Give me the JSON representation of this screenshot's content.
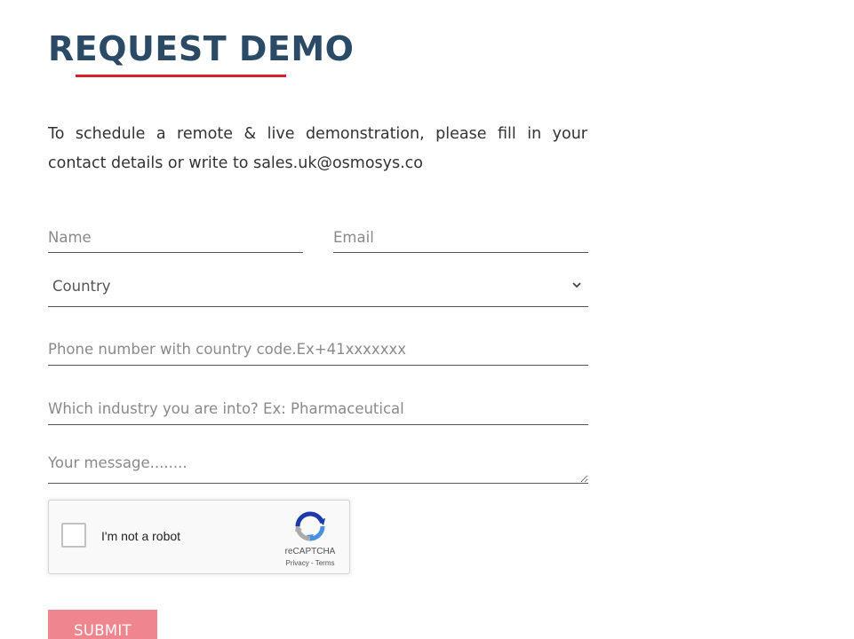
{
  "heading": {
    "title": "REQUEST DEMO",
    "accent_color": "#d3212d",
    "title_color": "#2b4a66"
  },
  "intro": {
    "text": "To schedule a remote & live demonstration, please fill in your contact details or write to sales.uk@osmosys.co"
  },
  "form": {
    "name_placeholder": "Name",
    "email_placeholder": "Email",
    "country": {
      "selected": "Country",
      "icon": "chevron-down-icon"
    },
    "phone_placeholder": "Phone number with country code.Ex+41xxxxxxx",
    "industry_placeholder": "Which industry you are into? Ex: Pharmaceutical",
    "message_placeholder": "Your message........",
    "submit_label": "SUBMIT",
    "submit_color": "#f0868d"
  },
  "recaptcha": {
    "label": "I'm not a robot",
    "brand": "reCAPTCHA",
    "privacy_link": "Privacy",
    "separator": " - ",
    "terms_link": "Terms",
    "icon": "recaptcha-logo-icon"
  }
}
